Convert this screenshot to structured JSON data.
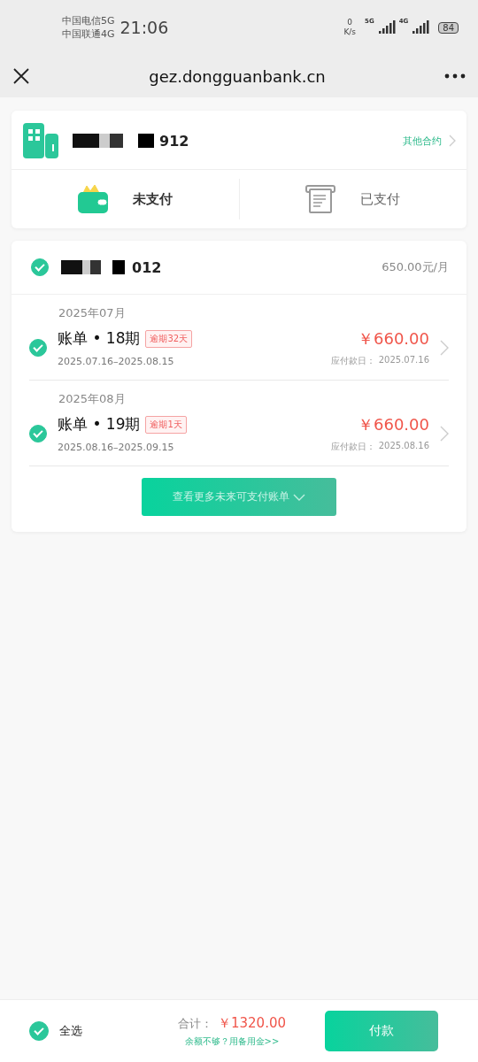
{
  "status_bar": {
    "carriers": [
      "中国电信5G",
      "中国联通4G"
    ],
    "time": "21:06",
    "net_speed": [
      "0",
      "K/s"
    ],
    "signals": [
      "5G",
      "4G"
    ],
    "battery": "84"
  },
  "nav": {
    "url": "gez.dongguanbank.cn"
  },
  "contract": {
    "name_suffix": "912",
    "other_link": "其他合约"
  },
  "tabs": [
    {
      "label": "未支付",
      "kind": "wallet",
      "selected": true
    },
    {
      "label": "已支付",
      "kind": "receipt",
      "selected": false
    }
  ],
  "group": {
    "checked": true,
    "name_suffix": "012",
    "rent": "650.00元/月",
    "bills": [
      {
        "month": "2025年07月",
        "title": "账单 • 18期",
        "badge": "逾期32天",
        "period": "2025.07.16–2025.08.15",
        "amount": "￥660.00",
        "due_label": "应付款日：",
        "due_date": "2025.07.16",
        "checked": true
      },
      {
        "month": "2025年08月",
        "title": "账单 • 19期",
        "badge": "逾期1天",
        "period": "2025.08.16–2025.09.15",
        "amount": "￥660.00",
        "due_label": "应付款日：",
        "due_date": "2025.08.16",
        "checked": true
      }
    ],
    "more_button": "查看更多未来可支付账单"
  },
  "footer": {
    "select_all": {
      "label": "全选",
      "checked": true
    },
    "total_label": "合计：",
    "total": "￥1320.00",
    "hint": "余额不够？用备用金>>",
    "pay": "付款"
  }
}
